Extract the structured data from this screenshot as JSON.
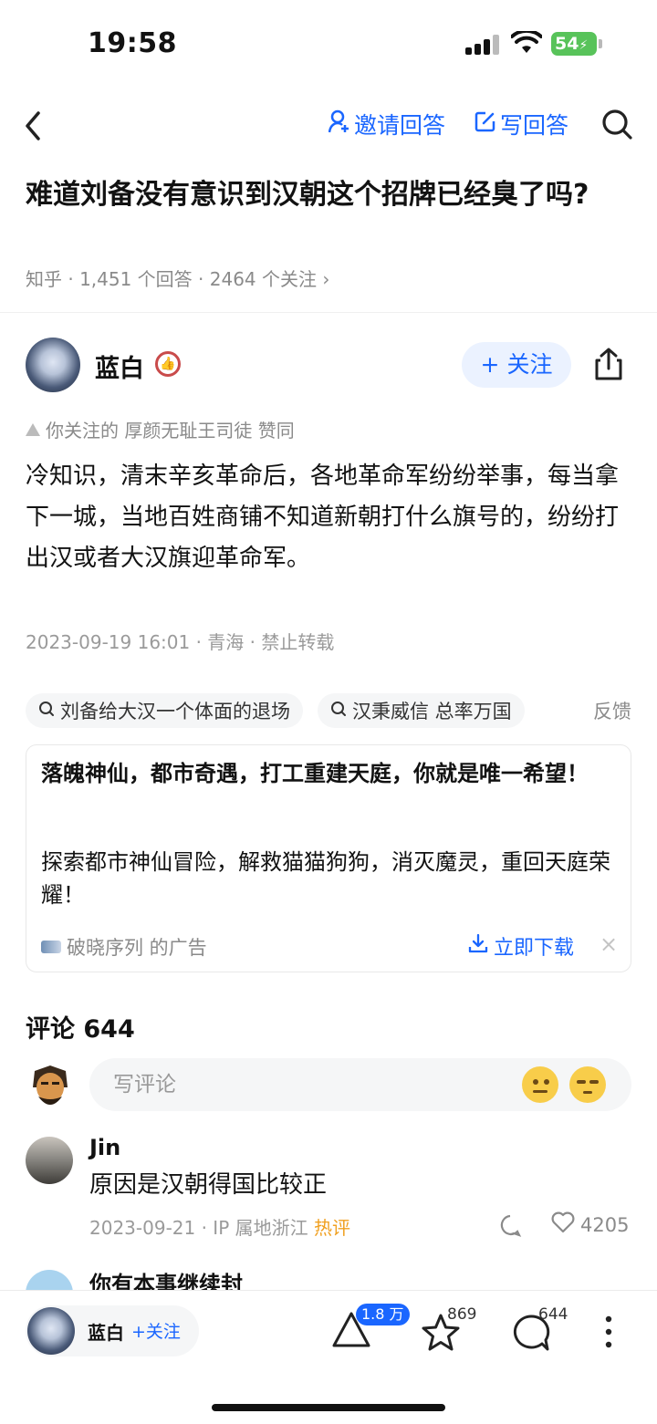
{
  "status": {
    "time": "19:58",
    "battery": "54"
  },
  "nav": {
    "invite": "邀请回答",
    "write": "写回答"
  },
  "question": {
    "title": "难道刘备没有意识到汉朝这个招牌已经臭了吗?",
    "meta": "知乎 · 1,451 个回答 · 2464 个关注 ›"
  },
  "author": {
    "name": "蓝白",
    "follow": "+ 关注"
  },
  "agree_line": "你关注的 厚颜无耻王司徒 赞同",
  "answer": {
    "text": "冷知识，清末辛亥革命后，各地革命军纷纷举事，每当拿下一城，当地百姓商铺不知道新朝打什么旗号的，纷纷打出汉或者大汉旗迎革命军。",
    "meta": "2023-09-19 16:01 · 青海 · 禁止转载"
  },
  "chips": [
    {
      "label": "刘备给大汉一个体面的退场"
    },
    {
      "label": "汉秉威信 总率万国"
    }
  ],
  "chips_tail": "反馈",
  "ad": {
    "title": "落魄神仙，都市奇遇，打工重建天庭，你就是唯一希望！",
    "body": "探索都市神仙冒险，解救猫猫狗狗，消灭魔灵，重回天庭荣耀！",
    "source": "破晓序列 的广告",
    "download": "立即下载",
    "close": "×"
  },
  "comments": {
    "header": "评论 644",
    "placeholder": "写评论",
    "items": [
      {
        "name": "Jin",
        "text": "原因是汉朝得国比较正",
        "meta": "2023-09-21 · IP 属地浙江",
        "hot": "热评",
        "likes": "4205"
      },
      {
        "name": "你有本事继续封"
      }
    ]
  },
  "bottom": {
    "author": "蓝白",
    "follow": "+关注",
    "upvote_badge": "1.8 万",
    "favorites": "869",
    "comments": "644"
  },
  "colors": {
    "accent": "#1a66ff",
    "hot": "#f0a020",
    "battery": "#58c35a"
  }
}
